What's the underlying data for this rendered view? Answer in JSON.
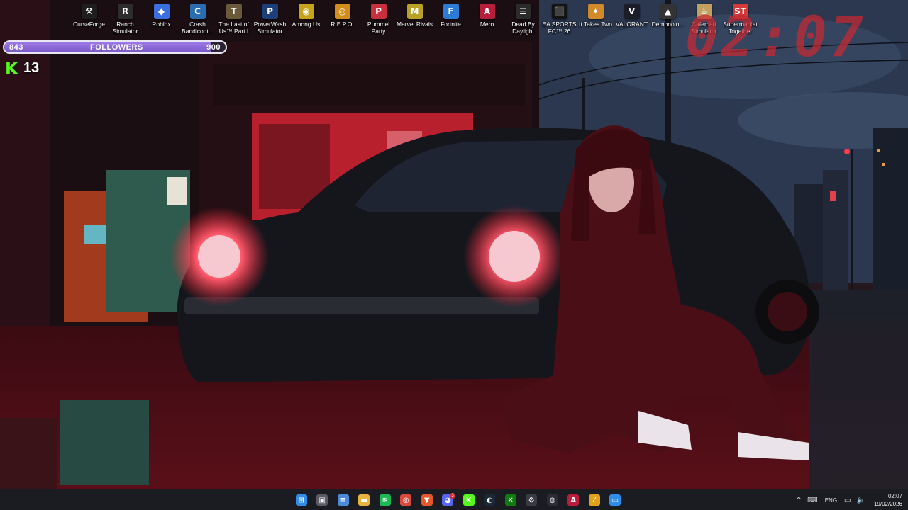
{
  "desktop_icons": [
    {
      "label": "CurseForge",
      "icon": "curseforge-icon",
      "color": "#1e1e1e",
      "glyph": "⚒"
    },
    {
      "label": "Ranch\nSimulator",
      "icon": "ranch-simulator-icon",
      "color": "#2d2d2d",
      "glyph": "R"
    },
    {
      "label": "Roblox",
      "icon": "roblox-icon",
      "color": "#3b6fe0",
      "glyph": "◆"
    },
    {
      "label": "Crash\nBandicoot...",
      "icon": "crash-bandicoot-icon",
      "color": "#2a6db0",
      "glyph": "C"
    },
    {
      "label": "The Last of\nUs™ Part I",
      "icon": "the-last-of-us-icon",
      "color": "#6b5a3a",
      "glyph": "T"
    },
    {
      "label": "PowerWash\nSimulator",
      "icon": "powerwash-icon",
      "color": "#1c3f7a",
      "glyph": "P"
    },
    {
      "label": "Among Us",
      "icon": "among-us-icon",
      "color": "#c7a21b",
      "glyph": "◉"
    },
    {
      "label": "R.E.P.O.",
      "icon": "repo-icon",
      "color": "#d38d1a",
      "glyph": "◎"
    },
    {
      "label": "Pummel\nParty",
      "icon": "pummel-party-icon",
      "color": "#c9303d",
      "glyph": "P"
    },
    {
      "label": "Marvel Rivals",
      "icon": "marvel-rivals-icon",
      "color": "#b9a227",
      "glyph": "M"
    },
    {
      "label": "Fortnite",
      "icon": "fortnite-icon",
      "color": "#2c7cd6",
      "glyph": "F"
    },
    {
      "label": "Mero",
      "icon": "mero-icon",
      "color": "#b81d3c",
      "glyph": "A"
    },
    {
      "label": "Dead By\nDaylight",
      "icon": "dead-by-daylight-icon",
      "color": "#2b2b2b",
      "glyph": "☰"
    },
    {
      "label": "EA SPORTS\nFC™ 26",
      "icon": "ea-sports-fc-icon",
      "color": "#141414",
      "glyph": "⬛"
    },
    {
      "label": "It Takes Two",
      "icon": "it-takes-two-icon",
      "color": "#d08a2a",
      "glyph": "✦"
    },
    {
      "label": "VALORANT",
      "icon": "valorant-icon",
      "color": "#1d1d2a",
      "glyph": "V"
    },
    {
      "label": "Demonolo...",
      "icon": "demonologist-icon",
      "color": "#333333",
      "glyph": "▲"
    },
    {
      "label": "Cafemart\nSimulator",
      "icon": "cafemart-icon",
      "color": "#c4a060",
      "glyph": "☕"
    },
    {
      "label": "Supermarket\nTogether",
      "icon": "supermarket-together-icon",
      "color": "#d33a3a",
      "glyph": "ST"
    }
  ],
  "followers_bar": {
    "current": "843",
    "label": "FOLLOWERS",
    "goal": "900",
    "progress": 0.937
  },
  "kick": {
    "count": "13",
    "color": "#53fc18"
  },
  "big_clock": "02:07",
  "taskbar": {
    "apps": [
      {
        "name": "start-icon",
        "color": "#2f8ce8",
        "glyph": "⊞"
      },
      {
        "name": "task-view-icon",
        "color": "#5a5a64",
        "glyph": "▣"
      },
      {
        "name": "notepad-icon",
        "color": "#4b8ad8",
        "glyph": "≡"
      },
      {
        "name": "file-explorer-icon",
        "color": "#e8b43c",
        "glyph": "▬"
      },
      {
        "name": "spotify-icon",
        "color": "#1db954",
        "glyph": "≋"
      },
      {
        "name": "chrome-icon",
        "color": "#d94a3c",
        "glyph": "◎"
      },
      {
        "name": "brave-icon",
        "color": "#e2582a",
        "glyph": "▼"
      },
      {
        "name": "discord-icon",
        "color": "#5865f2",
        "glyph": "◕",
        "badge": "3"
      },
      {
        "name": "kick-icon",
        "color": "#53fc18",
        "glyph": "K"
      },
      {
        "name": "steam-icon",
        "color": "#1b2838",
        "glyph": "◐"
      },
      {
        "name": "xbox-icon",
        "color": "#107c10",
        "glyph": "✕"
      },
      {
        "name": "settings-icon",
        "color": "#3a3a44",
        "glyph": "⚙"
      },
      {
        "name": "obs-icon",
        "color": "#2b2b35",
        "glyph": "◍"
      },
      {
        "name": "mero-taskbar-icon",
        "color": "#b81d3c",
        "glyph": "A"
      },
      {
        "name": "arrow-icon",
        "color": "#e0a21c",
        "glyph": "⁄"
      },
      {
        "name": "remote-desktop-icon",
        "color": "#2f8ce8",
        "glyph": "▭"
      }
    ],
    "tray": {
      "chevron": "^",
      "language": "ENG",
      "time": "02:07",
      "date": "19/02/2026"
    }
  }
}
